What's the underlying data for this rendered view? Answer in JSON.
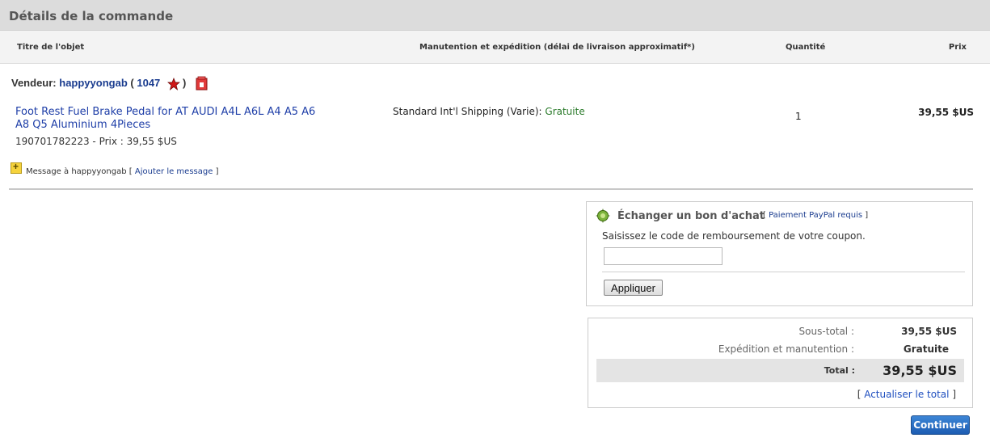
{
  "page": {
    "title": "Détails de la commande"
  },
  "columns": {
    "item_title": "Titre de l'objet",
    "shipping": "Manutention et expédition (délai de livraison approximatif*)",
    "quantity": "Quantité",
    "price": "Prix"
  },
  "seller": {
    "label": "Vendeur:",
    "name": "happyyongab",
    "open_paren": "(",
    "score": "1047",
    "close_paren": ")",
    "star_icon": "red-star-icon",
    "shop_icon": "store-icon"
  },
  "item": {
    "title": "Foot Rest Fuel Brake Pedal for AT AUDI A4L A6L A4 A5 A6 A8 Q5 Aluminium 4Pieces",
    "id_price": "190701782223 - Prix : 39,55 $US",
    "shipping_service": "Standard Int'l Shipping (Varie):",
    "shipping_cost": "Gratuite",
    "quantity": "1",
    "price": "39,55 $US"
  },
  "message": {
    "icon": "add-note-icon",
    "text": "Message à happyyongab",
    "bracket_open": "[",
    "link": "Ajouter le message",
    "bracket_close": "]"
  },
  "coupon": {
    "icon": "coupon-icon",
    "title": "Échanger un bon d'achat",
    "bracket_open": "[",
    "link": "Paiement PayPal requis",
    "bracket_close": "]",
    "description": "Saisissez le code de remboursement de votre coupon.",
    "input_value": "",
    "apply_label": "Appliquer"
  },
  "totals": {
    "subtotal_label": "Sous-total :",
    "subtotal_value": "39,55 $US",
    "shipping_label": "Expédition et manutention :",
    "shipping_value": "Gratuite",
    "total_label": "Total :",
    "total_value": "39,55 $US",
    "bracket_open": "[",
    "update_link": "Actualiser le total",
    "bracket_close": "]"
  },
  "actions": {
    "continue_label": "Continuer"
  },
  "colors": {
    "link": "#1a3c8f",
    "free_shipping": "#2a7a2a",
    "continue_button": "#1c5cb2",
    "title_bar": "#dcdcdc"
  }
}
